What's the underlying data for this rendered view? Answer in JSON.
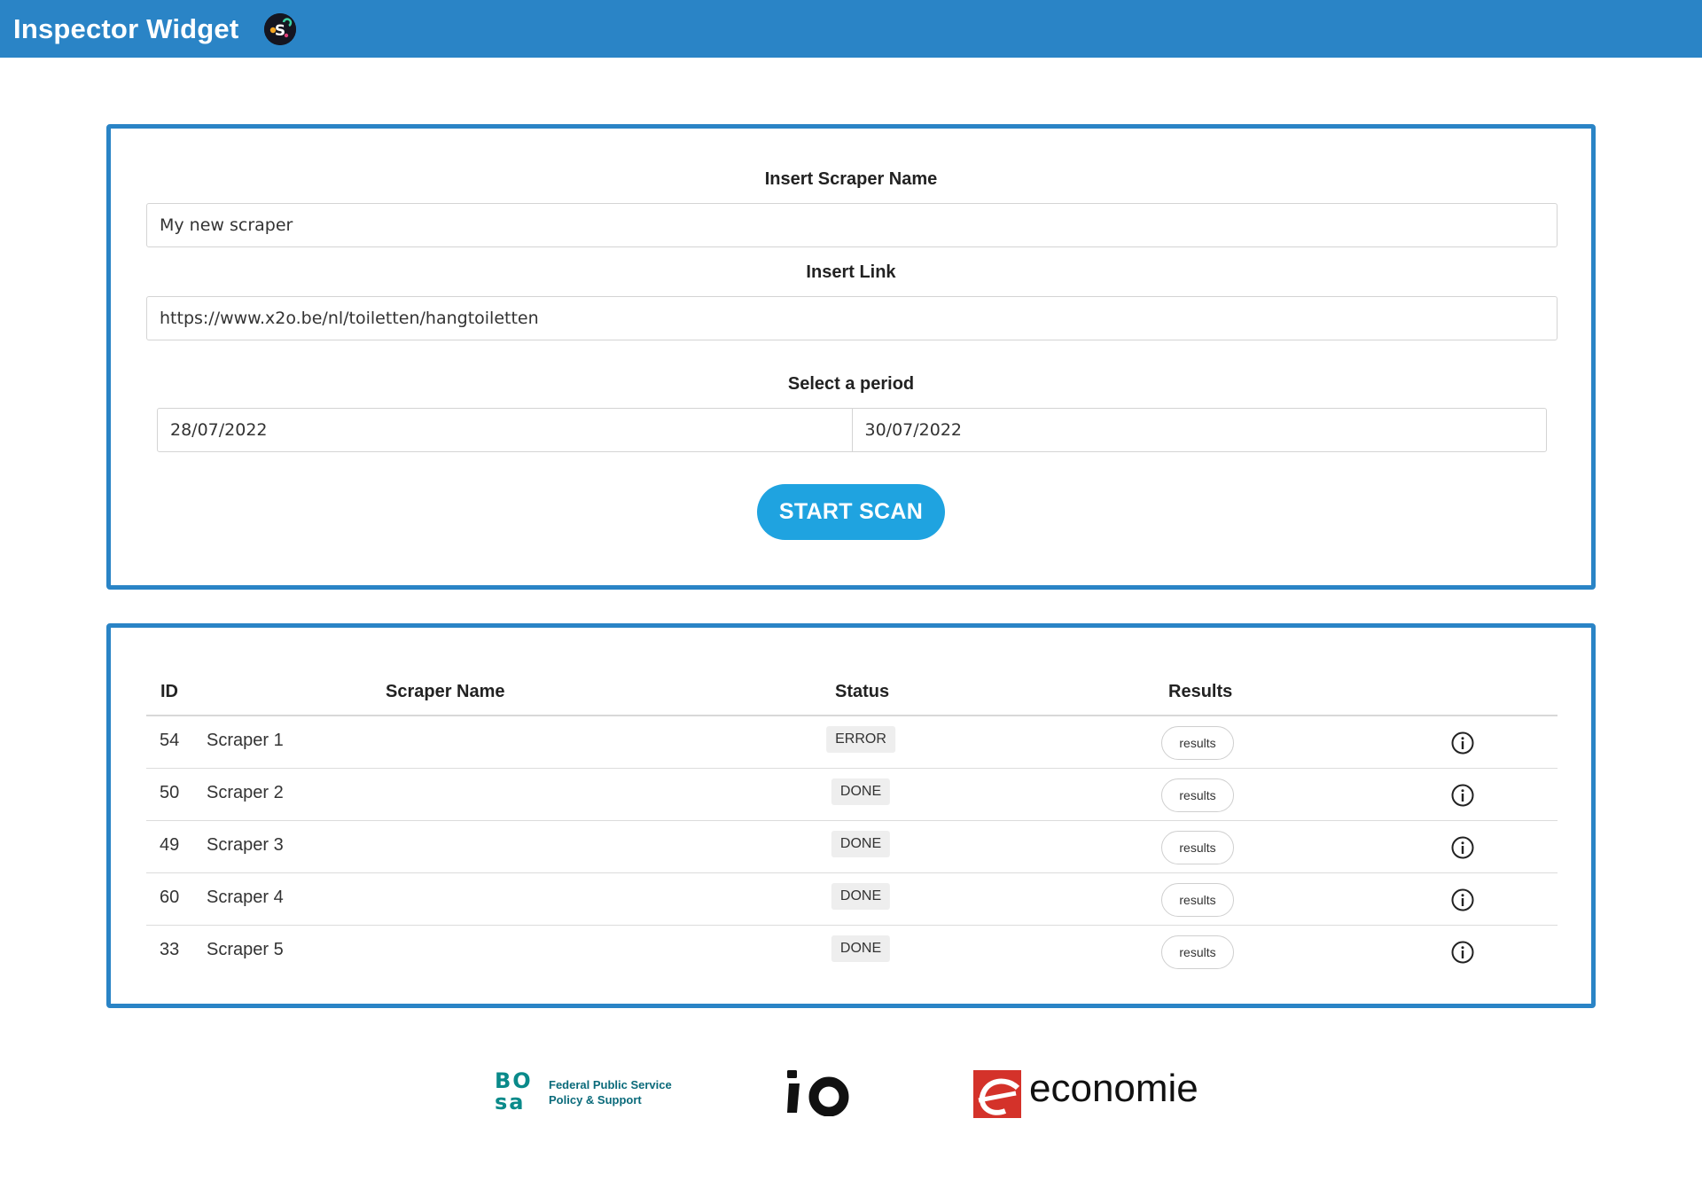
{
  "header": {
    "title": "Inspector Widget",
    "logo_icon": "inspector-widget-logo"
  },
  "form": {
    "scraper_name_label": "Insert Scraper Name",
    "scraper_name_value": "My new scraper",
    "link_label": "Insert Link",
    "link_value": "https://www.x2o.be/nl/toiletten/hangtoiletten",
    "period_label": "Select a period",
    "period_start": "28/07/2022",
    "period_end": "30/07/2022",
    "start_button": "START SCAN"
  },
  "table": {
    "columns": [
      "ID",
      "Scraper Name",
      "Status",
      "Results"
    ],
    "rows": [
      {
        "id": "54",
        "name": "Scraper 1",
        "status": "ERROR",
        "results": "results"
      },
      {
        "id": "50",
        "name": "Scraper 2",
        "status": "DONE",
        "results": "results"
      },
      {
        "id": "49",
        "name": "Scraper 3",
        "status": "DONE",
        "results": "results"
      },
      {
        "id": "60",
        "name": "Scraper 4",
        "status": "DONE",
        "results": "results"
      },
      {
        "id": "33",
        "name": "Scraper 5",
        "status": "DONE",
        "results": "results"
      }
    ]
  },
  "footer": {
    "bosa_mark_top": "BO",
    "bosa_mark_bottom": "sa",
    "bosa_line1": "Federal Public Service",
    "bosa_line2": "Policy & Support",
    "io_logo": "io-logo",
    "economie_text": "economie"
  },
  "colors": {
    "accent": "#2a84c6",
    "button": "#1fa3e0"
  }
}
